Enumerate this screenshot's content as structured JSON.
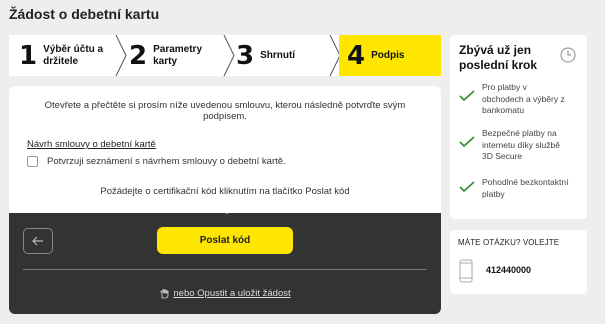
{
  "page": {
    "title": "Žádost o debetní kartu"
  },
  "stepper": {
    "steps": [
      {
        "number": "1",
        "label_line1": "Výběr účtu a",
        "label_line2": "držitele"
      },
      {
        "number": "2",
        "label_line1": "Parametry",
        "label_line2": "karty"
      },
      {
        "number": "3",
        "label_line1": "Shrnutí",
        "label_line2": ""
      },
      {
        "number": "4",
        "label_line1": "Podpis",
        "label_line2": ""
      }
    ],
    "active_color": "#ffe600"
  },
  "main": {
    "intro_text": "Otevřete a přečtěte si prosím níže uvedenou smlouvu, kterou následně potvrďte svým podpisem.",
    "contract_link": "Návrh smlouvy o debetní kartě",
    "checkbox_label": "Potvrzuji seznámení s návrhem smlouvy o debetní kartě.",
    "checkbox_checked": false,
    "cert_text": "Požádejte o certifikační kód kliknutím na tlačítko Poslat kód",
    "back_icon": "arrow-left-icon",
    "send_button": "Poslat kód",
    "save_link": "nebo Opustit a uložit žádost",
    "save_icon": "hand-icon"
  },
  "side": {
    "title": "Zbývá už jen poslední krok",
    "clock_icon": "clock-icon",
    "benefits": [
      {
        "l1": "Pro platby v",
        "l2": "obchodech a výběry z",
        "l3": "bankomatu"
      },
      {
        "l1": "Bezpečné platby na",
        "l2": "internetu díky službě",
        "l3": "3D Secure"
      },
      {
        "l1": "Pohodlné bezkontaktní",
        "l2": "platby",
        "l3": ""
      }
    ],
    "check_color": "#2e8b2e"
  },
  "contact": {
    "title": "MÁTE OTÁZKU? VOLEJTE",
    "phone_icon": "phone-icon",
    "phone": "412440000"
  }
}
